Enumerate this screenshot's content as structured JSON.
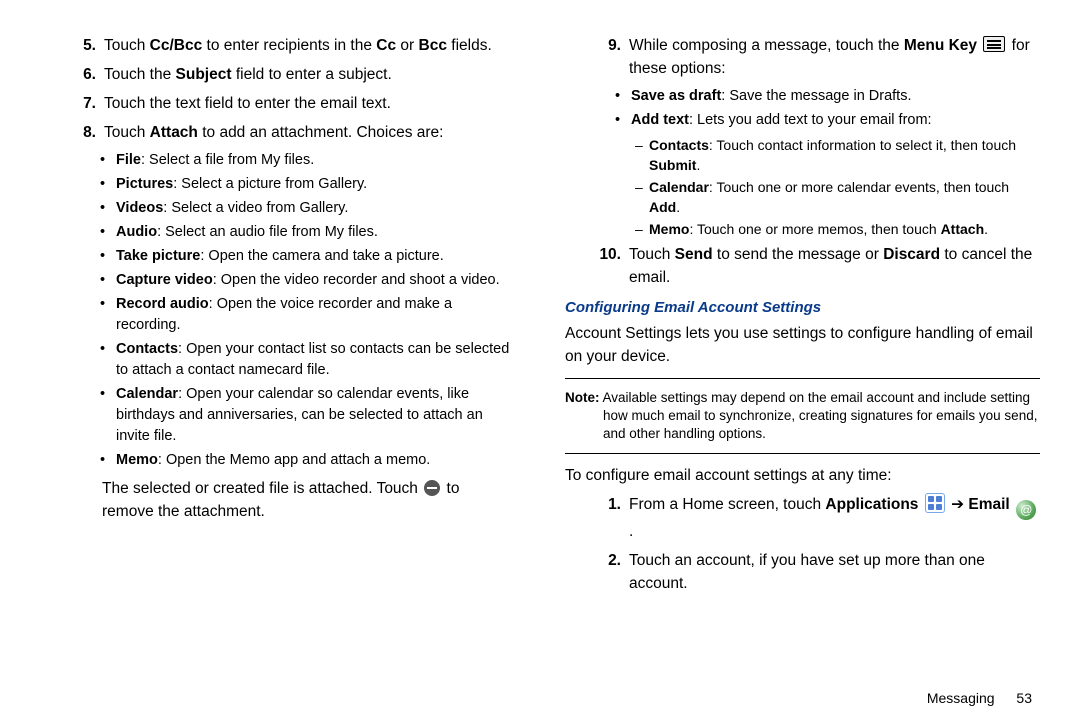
{
  "left": {
    "items": [
      {
        "num": "5.",
        "segs": [
          "Touch ",
          {
            "b": "Cc/Bcc"
          },
          " to enter recipients in the ",
          {
            "b": "Cc"
          },
          " or ",
          {
            "b": "Bcc"
          },
          " fields."
        ]
      },
      {
        "num": "6.",
        "segs": [
          "Touch the ",
          {
            "b": "Subject"
          },
          " field to enter a subject."
        ]
      },
      {
        "num": "7.",
        "segs": [
          "Touch the text field to enter the email text."
        ]
      },
      {
        "num": "8.",
        "segs": [
          "Touch ",
          {
            "b": "Attach"
          },
          " to add an attachment. Choices are:"
        ]
      }
    ],
    "attach_options": [
      [
        {
          "b": "File"
        },
        ": Select a file from My files."
      ],
      [
        {
          "b": "Pictures"
        },
        ": Select a picture from Gallery."
      ],
      [
        {
          "b": "Videos"
        },
        ": Select a video from Gallery."
      ],
      [
        {
          "b": "Audio"
        },
        ": Select an audio file from My files."
      ],
      [
        {
          "b": "Take picture"
        },
        ": Open the camera and take a picture."
      ],
      [
        {
          "b": "Capture video"
        },
        ": Open the video recorder and shoot a video."
      ],
      [
        {
          "b": "Record audio"
        },
        ": Open the voice recorder and make a recording."
      ],
      [
        {
          "b": "Contacts"
        },
        ": Open your contact list so contacts can be selected to attach a contact namecard file."
      ],
      [
        {
          "b": "Calendar"
        },
        ": Open your calendar so calendar events, like birthdays and anniversaries, can be selected to attach an invite file."
      ],
      [
        {
          "b": "Memo"
        },
        ": Open the Memo app and attach a memo."
      ]
    ],
    "after_attach": [
      "The selected or created file is attached. Touch ",
      {
        "icon": "minus"
      },
      " to remove the attachment."
    ]
  },
  "right": {
    "item9": {
      "num": "9.",
      "segs": [
        "While composing a message, touch the ",
        {
          "b": "Menu Key"
        },
        " ",
        {
          "icon": "menu"
        },
        " for these options:"
      ]
    },
    "options9": [
      [
        {
          "b": "Save as draft"
        },
        ": Save the message in Drafts."
      ],
      [
        {
          "b": "Add text"
        },
        ": Lets you add text to your email from:"
      ]
    ],
    "addtext_sub": [
      [
        {
          "b": "Contacts"
        },
        ": Touch contact information to select it, then touch ",
        {
          "b": "Submit"
        },
        "."
      ],
      [
        {
          "b": "Calendar"
        },
        ": Touch one or more calendar events, then touch ",
        {
          "b": "Add"
        },
        "."
      ],
      [
        {
          "b": "Memo"
        },
        ": Touch one or more memos, then touch ",
        {
          "b": "Attach"
        },
        "."
      ]
    ],
    "item10": {
      "num": "10.",
      "segs": [
        "Touch ",
        {
          "b": "Send"
        },
        " to send the message or ",
        {
          "b": "Discard"
        },
        " to cancel the email."
      ]
    },
    "heading": "Configuring Email Account Settings",
    "intro": "Account Settings lets you use settings to configure handling of email on your device.",
    "note_label": "Note:",
    "note_body": "Available settings may depend on the email account and include setting how much email to synchronize, creating signatures for emails you send, and other handling options.",
    "lead_in": "To configure email account settings at any time:",
    "steps": [
      {
        "num": "1.",
        "segs": [
          "From a Home screen, touch ",
          {
            "b": "Applications"
          },
          " ",
          {
            "icon": "apps"
          },
          " ",
          {
            "arrow": true
          },
          " ",
          {
            "b": "Email"
          },
          " ",
          {
            "icon": "email"
          },
          " ."
        ]
      },
      {
        "num": "2.",
        "segs": [
          "Touch an account, if you have set up more than one account."
        ]
      }
    ]
  },
  "footer": {
    "section": "Messaging",
    "page": "53"
  }
}
